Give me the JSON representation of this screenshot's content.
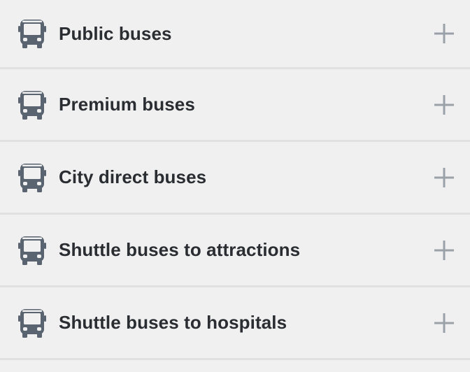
{
  "accordion": {
    "items": [
      {
        "label": "Public buses",
        "icon": "bus-icon",
        "action_icon": "plus-icon"
      },
      {
        "label": "Premium buses",
        "icon": "bus-icon",
        "action_icon": "plus-icon"
      },
      {
        "label": "City direct buses",
        "icon": "bus-icon",
        "action_icon": "plus-icon"
      },
      {
        "label": "Shuttle buses to attractions",
        "icon": "bus-icon",
        "action_icon": "plus-icon"
      },
      {
        "label": "Shuttle buses to hospitals",
        "icon": "bus-icon",
        "action_icon": "plus-icon"
      }
    ]
  },
  "colors": {
    "background": "#f0f0f0",
    "divider": "#e0e0e0",
    "text": "#2a2d31",
    "icon": "#5a6470",
    "plus": "#9aa1a8"
  }
}
